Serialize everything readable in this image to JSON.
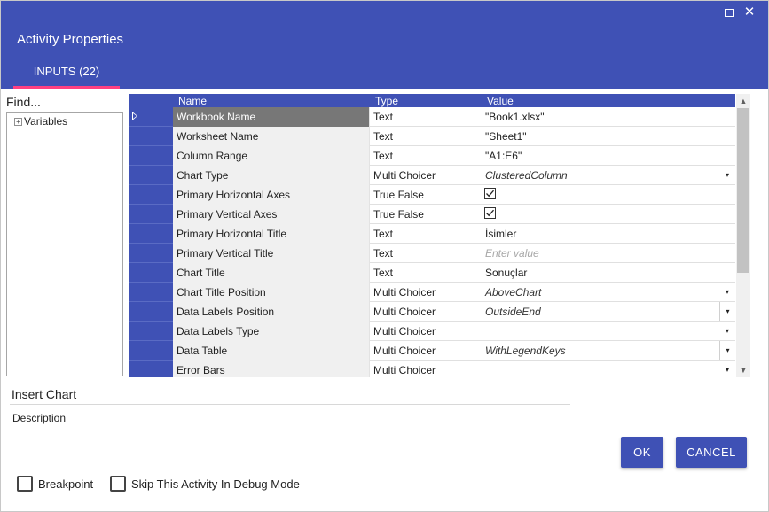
{
  "dialog": {
    "title": "Activity Properties",
    "tab_inputs": "INPUTS (22)",
    "maximize_icon": "maximize-icon",
    "close_icon": "close-icon",
    "close_glyph": "✕"
  },
  "left_pane": {
    "find_label": "Find...",
    "tree": [
      {
        "label": "Variables",
        "expander": "⊞"
      }
    ]
  },
  "grid": {
    "headers": {
      "name": "Name",
      "type": "Type",
      "value": "Value"
    },
    "rows": [
      {
        "name": "Workbook Name",
        "type": "Text",
        "value": "\"Book1.xlsx\""
      },
      {
        "name": "Worksheet Name",
        "type": "Text",
        "value": "\"Sheet1\""
      },
      {
        "name": "Column Range",
        "type": "Text",
        "value": "\"A1:E6\""
      },
      {
        "name": "Chart Type",
        "type": "Multi Choicer",
        "value": "ClusteredColumn"
      },
      {
        "name": "Primary Horizontal Axes",
        "type": "True False",
        "checked": true
      },
      {
        "name": "Primary Vertical Axes",
        "type": "True False",
        "checked": true
      },
      {
        "name": "Primary Horizontal Title",
        "type": "Text",
        "value": "İsimler"
      },
      {
        "name": "Primary Vertical Title",
        "type": "Text",
        "placeholder": "Enter value"
      },
      {
        "name": "Chart Title",
        "type": "Text",
        "value": "Sonuçlar"
      },
      {
        "name": "Chart Title Position",
        "type": "Multi Choicer",
        "value": "AboveChart"
      },
      {
        "name": "Data Labels Position",
        "type": "Multi Choicer",
        "value": "OutsideEnd"
      },
      {
        "name": "Data Labels Type",
        "type": "Multi Choicer",
        "value": ""
      },
      {
        "name": "Data Table",
        "type": "Multi Choicer",
        "value": "WithLegendKeys"
      },
      {
        "name": "Error Bars",
        "type": "Multi Choicer",
        "value": ""
      }
    ],
    "dropdown_glyph": "▾"
  },
  "scrollbar": {
    "up_glyph": "▲",
    "down_glyph": "▼"
  },
  "description": {
    "activity_name": "Insert Chart",
    "label": "Description"
  },
  "buttons": {
    "ok": "OK",
    "cancel": "CANCEL"
  },
  "options": {
    "breakpoint": "Breakpoint",
    "skip_debug": "Skip This Activity In Debug Mode"
  },
  "colors": {
    "accent": "#3f51b5",
    "tab_indicator": "#ff4081",
    "selected_row": "#777777"
  }
}
